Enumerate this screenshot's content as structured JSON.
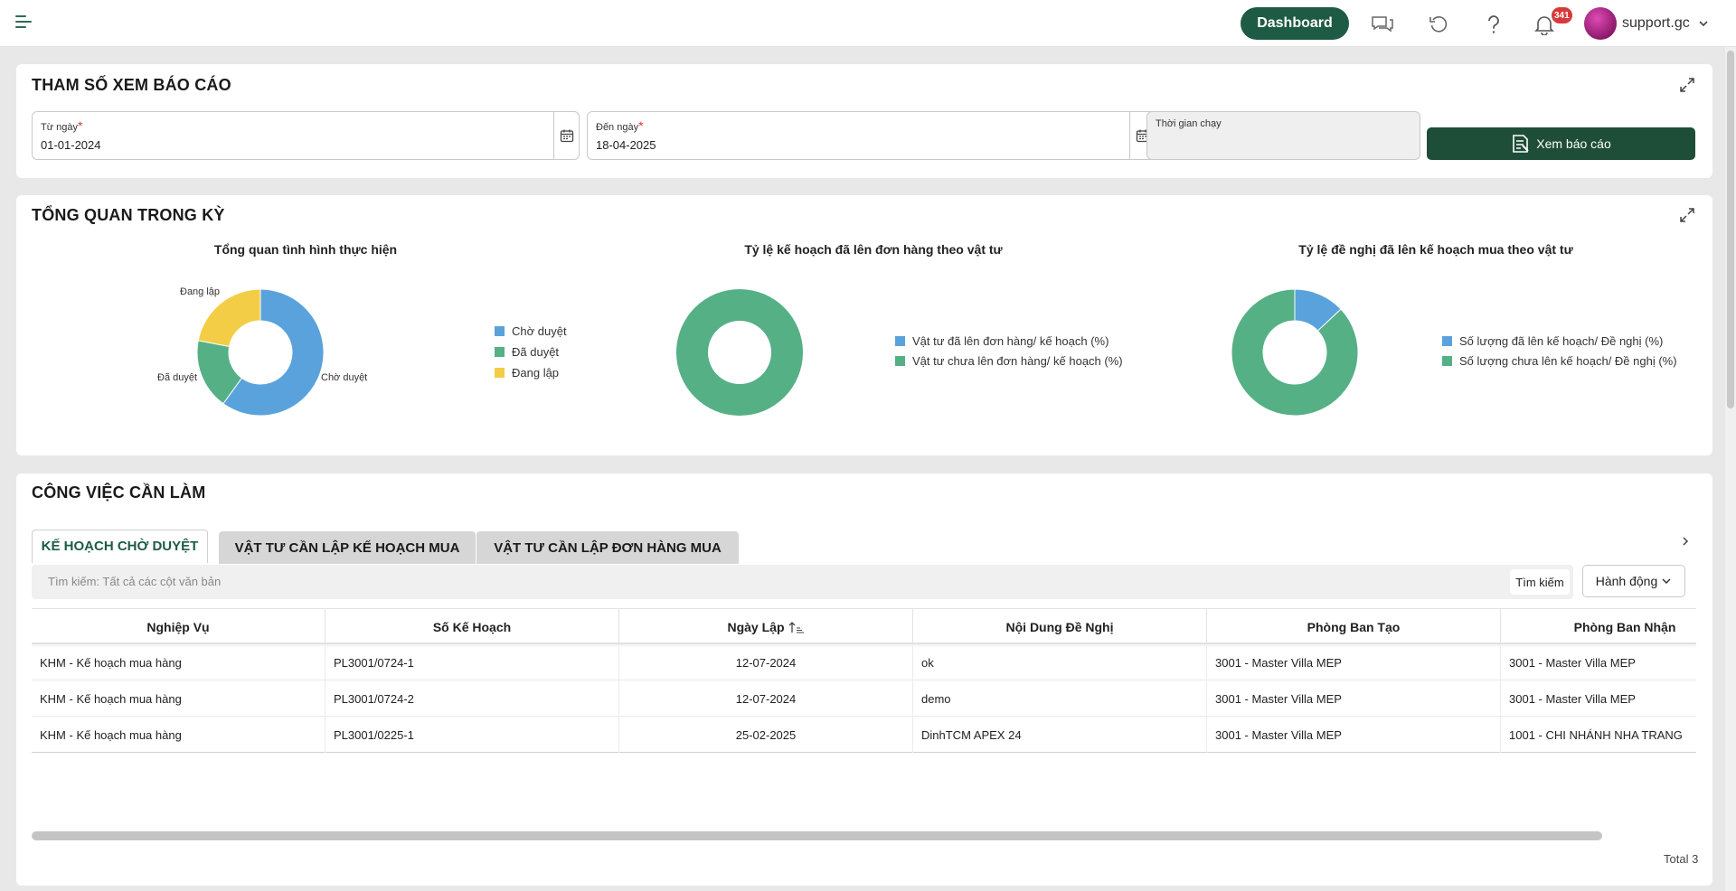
{
  "header": {
    "dashboard_label": "Dashboard",
    "notification_count": "341",
    "user_name": "support.gc",
    "icons": [
      "menu-icon",
      "chat-icon",
      "refresh-icon",
      "help-icon",
      "bell-icon",
      "chevron-down-icon"
    ]
  },
  "params": {
    "title": "THAM SỐ XEM BÁO CÁO",
    "from_label": "Từ ngày",
    "from_value": "01-01-2024",
    "to_label": "Đến ngày",
    "to_value": "18-04-2025",
    "runtime_label": "Thời gian chạy",
    "required_mark": "*",
    "view_button": "Xem báo cáo"
  },
  "overview": {
    "title": "TỔNG QUAN TRONG KỲ"
  },
  "chart_data": [
    {
      "type": "pie",
      "title": "Tổng quan tình hình thực hiện",
      "categories": [
        "Chờ duyệt",
        "Đã duyệt",
        "Đang lập"
      ],
      "values": [
        60,
        18,
        22
      ],
      "colors": [
        "#5aa2dc",
        "#55b085",
        "#f3cd45"
      ],
      "legend": "right"
    },
    {
      "type": "pie",
      "title": "Tỷ lệ kế hoạch đã lên đơn hàng theo vật tư",
      "categories": [
        "Vật tư đã lên đơn hàng/ kế hoạch (%)",
        "Vật tư chưa lên đơn hàng/ kế hoạch (%)"
      ],
      "values": [
        0,
        100
      ],
      "colors": [
        "#5aa2dc",
        "#55b085"
      ],
      "legend": "right"
    },
    {
      "type": "pie",
      "title": "Tỷ lệ đề nghị đã lên kế hoạch mua theo vật tư",
      "categories": [
        "Số lượng đã lên kế hoạch/ Đề nghị (%)",
        "Số lượng chưa lên kế hoạch/ Đề nghị (%)"
      ],
      "values": [
        13,
        87
      ],
      "colors": [
        "#5aa2dc",
        "#55b085"
      ],
      "legend": "right"
    }
  ],
  "tasks": {
    "title": "CÔNG VIỆC CẦN LÀM",
    "tabs": [
      "KẾ HOẠCH CHỜ DUYỆT",
      "VẬT TƯ CẦN LẬP KẾ HOẠCH MUA",
      "VẬT TƯ CẦN LẬP ĐƠN HÀNG MUA"
    ],
    "search_placeholder": "Tìm kiếm: Tất cả các cột văn bản",
    "search_button": "Tìm kiếm",
    "action_button": "Hành động",
    "columns": [
      "Nghiệp Vụ",
      "Số Kế Hoạch",
      "Ngày Lập",
      "Nội Dung Đề Nghị",
      "Phòng Ban Tạo",
      "Phòng Ban Nhận"
    ],
    "rows": [
      [
        "KHM - Kế hoạch mua hàng",
        "PL3001/0724-1",
        "12-07-2024",
        "ok",
        "3001 - Master Villa MEP",
        "3001 - Master Villa MEP"
      ],
      [
        "KHM - Kế hoạch mua hàng",
        "PL3001/0724-2",
        "12-07-2024",
        "demo",
        "3001 - Master Villa MEP",
        "3001 - Master Villa MEP"
      ],
      [
        "KHM - Kế hoạch mua hàng",
        "PL3001/0225-1",
        "25-02-2025",
        "DinhTCM APEX 24",
        "3001 - Master Villa MEP",
        "1001 - CHI NHÁNH NHA TRANG"
      ]
    ],
    "total": "Total 3"
  }
}
